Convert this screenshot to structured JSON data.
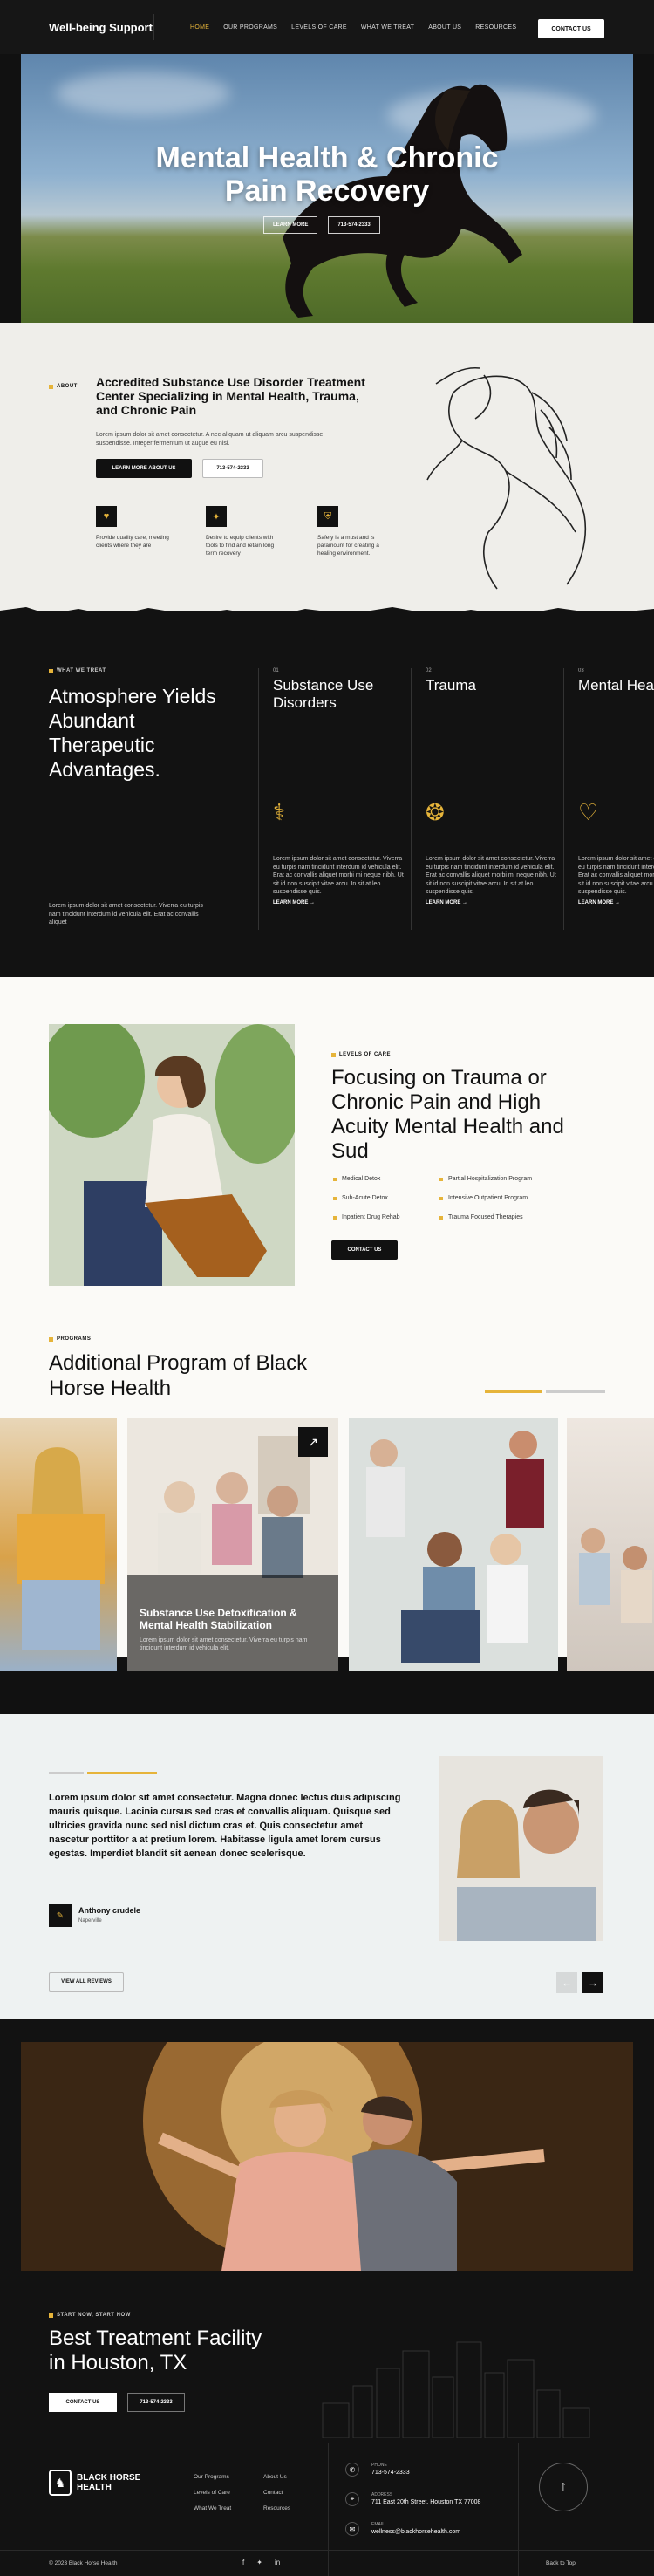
{
  "nav": {
    "logo": "Well-being Support",
    "links": [
      "HOME",
      "OUR PROGRAMS",
      "LEVELS OF CARE",
      "WHAT WE TREAT",
      "ABOUT US",
      "RESOURCES"
    ],
    "cta": "CONTACT US"
  },
  "hero": {
    "title_line1": "Mental Health & Chronic",
    "title_line2": "Pain Recovery",
    "btn1": "LEARN MORE",
    "btn2": "713-574-2333"
  },
  "about": {
    "tag": "ABOUT",
    "title": "Accredited Substance Use Disorder Treatment Center Specializing in Mental Health, Trauma, and Chronic Pain",
    "lead": "Lorem ipsum dolor sit amet consectetur. A nec aliquam ut aliquam arcu suspendisse suspendisse. Integer fermentum ut augue eu nisl.",
    "btn1": "LEARN MORE ABOUT US",
    "btn2": "713-574-2333",
    "features": [
      {
        "icon": "heart-icon",
        "text": "Provide quality care, meeting clients where they are"
      },
      {
        "icon": "tools-icon",
        "text": "Desire to equip clients with tools to find and retain long term recovery"
      },
      {
        "icon": "shield-icon",
        "text": "Safety is a must and is paramount for creating a healing environment."
      }
    ]
  },
  "treat": {
    "tag": "WHAT WE TREAT",
    "title": "Atmosphere Yields Abundant Therapeutic Advantages.",
    "desc": "Lorem ipsum dolor sit amet consectetur. Viverra eu turpis nam tincidunt interdum id vehicula elit. Erat ac convallis aliquet",
    "columns": [
      {
        "num": "01",
        "title": "Substance Use Disorders",
        "icon": "pills-icon",
        "text": "Lorem ipsum dolor sit amet consectetur. Viverra eu turpis nam tincidunt interdum id vehicula elit. Erat ac convallis aliquet morbi mi neque nibh. Ut sit id non suscipit vitae arcu. In sit at leo suspendisse quis.",
        "more": "LEARN MORE →"
      },
      {
        "num": "02",
        "title": "Trauma",
        "icon": "brain-icon",
        "text": "Lorem ipsum dolor sit amet consectetur. Viverra eu turpis nam tincidunt interdum id vehicula elit. Erat ac convallis aliquet morbi mi neque nibh. Ut sit id non suscipit vitae arcu. In sit at leo suspendisse quis.",
        "more": "LEARN MORE →"
      },
      {
        "num": "03",
        "title": "Mental Heal",
        "icon": "head-heart-icon",
        "text": "Lorem ipsum dolor sit amet consectetur. Viverra eu turpis nam tincidunt interdum id vehicula elit. Erat ac convallis aliquet morbi mi neque nibh. Ut sit id non suscipit vitae arcu. In sit at leo suspendisse quis.",
        "more": "LEARN MORE →"
      }
    ]
  },
  "levels": {
    "tag": "LEVELS OF CARE",
    "title": "Focusing on Trauma or Chronic Pain and High Acuity Mental Health and Sud",
    "items_left": [
      "Medical Detox",
      "Sub-Acute Detox",
      "Inpatient Drug Rehab"
    ],
    "items_right": [
      "Partial Hospitalization Program",
      "Intensive Outpatient Program",
      "Trauma Focused Therapies"
    ],
    "btn": "CONTACT US"
  },
  "programs": {
    "tag": "PROGRAMS",
    "title": "Additional Program of Black Horse Health",
    "card_title": "Substance Use Detoxification & Mental Health Stabilization",
    "card_text": "Lorem ipsum dolor sit amet consectetur. Viverra eu turpis nam tincidunt interdum id vehicula elit."
  },
  "testimonial": {
    "quote": "Lorem ipsum dolor sit amet consectetur. Magna donec lectus duis adipiscing mauris quisque. Lacinia cursus sed cras et convallis aliquam. Quisque sed ultricies gravida nunc sed nisl dictum cras et. Quis consectetur amet nascetur porttitor a at pretium lorem. Habitasse ligula amet lorem cursus egestas. Imperdiet blandit sit aenean donec scelerisque.",
    "name": "Anthony crudele",
    "location": "Naperville",
    "btn": "VIEW ALL REVIEWS"
  },
  "cta": {
    "tag": "START NOW, START NOW",
    "title_line1": "Best Treatment Facility",
    "title_line2": "in Houston, TX",
    "btn1": "CONTACT US",
    "btn2": "713-574-2333"
  },
  "footer": {
    "logo_line1": "BLACK HORSE",
    "logo_line2": "HEALTH",
    "links_col1": [
      "Our Programs",
      "Levels of Care",
      "What We Treat"
    ],
    "links_col2": [
      "About Us",
      "Contact",
      "Resources"
    ],
    "phone_label": "PHONE",
    "phone": "713-574-2333",
    "address_label": "ADDRESS",
    "address": "711 East 20th Street, Houston TX 77008",
    "email_label": "EMAIL",
    "email": "wellness@blackhorsehealth.com",
    "copyright": "© 2023 Black Horse Health",
    "back_to_top": "Back to Top"
  },
  "colors": {
    "accent": "#e6b43a",
    "dark": "#121212",
    "light": "#efeeea"
  }
}
